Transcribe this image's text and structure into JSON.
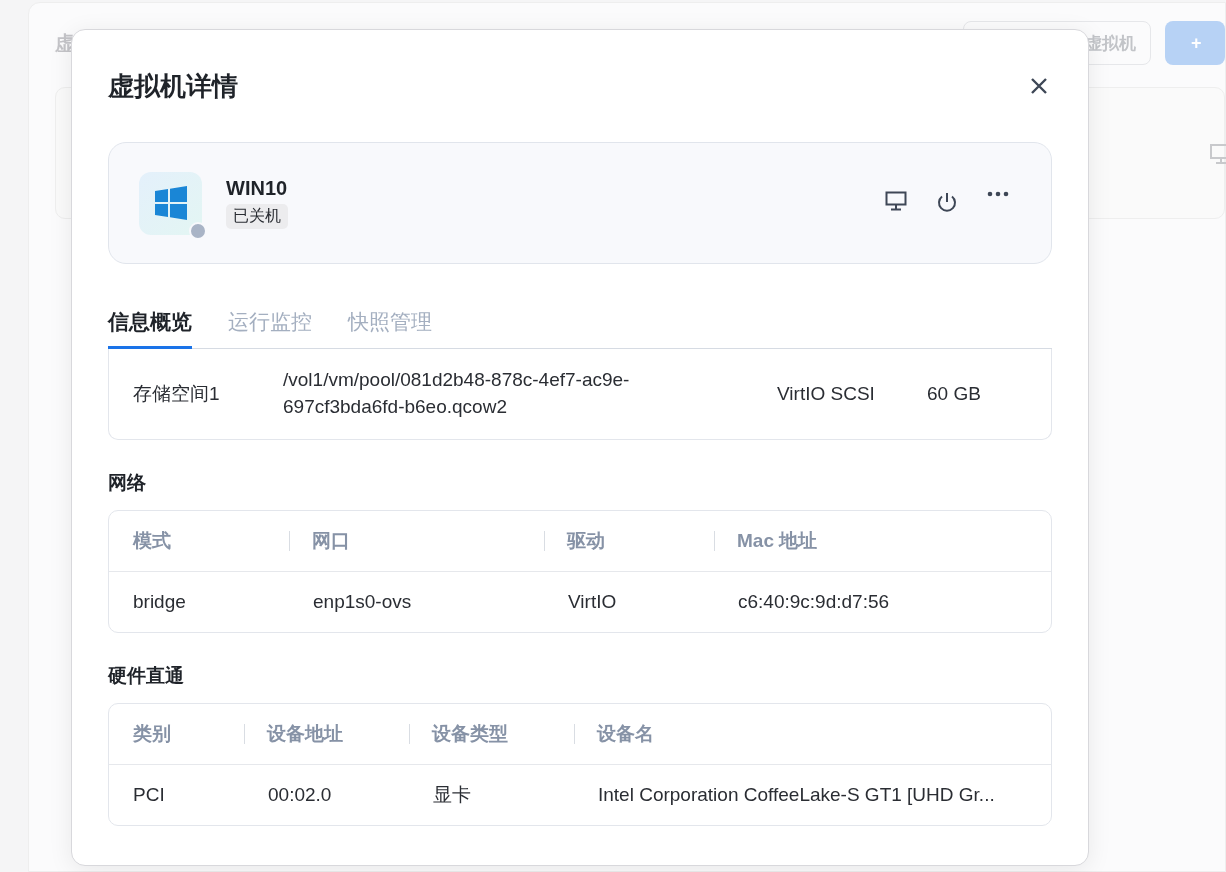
{
  "background": {
    "title": "虚",
    "buttons": [
      {
        "label": "虚拟机",
        "kind": "outline"
      },
      {
        "label": "+",
        "kind": "primary"
      }
    ]
  },
  "dialog": {
    "title": "虚拟机详情",
    "vm": {
      "name": "WIN10",
      "status": "已关机",
      "running": false
    },
    "tabs": [
      {
        "label": "信息概览",
        "selected": true
      },
      {
        "label": "运行监控",
        "selected": false
      },
      {
        "label": "快照管理",
        "selected": false
      }
    ],
    "storage": {
      "rows": [
        [
          "存储空间1",
          "/vol1/vm/pool/081d2b48-878c-4ef7-ac9e-697cf3bda6fd-b6eo.qcow2",
          "VirtIO SCSI",
          "60 GB"
        ]
      ]
    },
    "network": {
      "title": "网络",
      "columns": [
        "模式",
        "网口",
        "驱动",
        "Mac 地址"
      ],
      "rows": [
        [
          "bridge",
          "enp1s0-ovs",
          "VirtIO",
          "c6:40:9c:9d:d7:56"
        ]
      ]
    },
    "passthrough": {
      "title": "硬件直通",
      "columns": [
        "类别",
        "设备地址",
        "设备类型",
        "设备名"
      ],
      "rows": [
        [
          "PCI",
          "00:02.0",
          "显卡",
          "Intel Corporation CoffeeLake-S GT1 [UHD Gr..."
        ]
      ]
    }
  }
}
